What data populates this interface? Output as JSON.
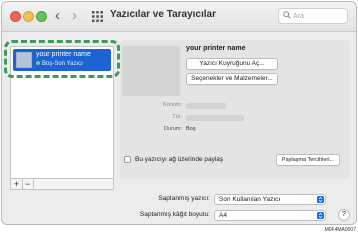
{
  "window": {
    "title": "Yazıcılar ve Tarayıcılar",
    "search_placeholder": "Ara",
    "nav_back_icon": "‹",
    "nav_forward_icon": "›"
  },
  "printer_list": {
    "items": [
      {
        "name": "your printer name",
        "status": "Boş-Son Yazıcı",
        "selected": true
      }
    ],
    "add_label": "+",
    "remove_label": "−"
  },
  "detail": {
    "printer_name": "your printer name",
    "open_queue_button": "Yazıcı Kuyruğunu Aç...",
    "options_button": "Seçenekler ve Malzemeler...",
    "location_label": "Konum:",
    "type_label": "Tür:",
    "status_label": "Durum:",
    "status_value": "Boş",
    "share_checkbox_label": "Bu yazıcıyı ağ üzerinde paylaş",
    "share_checked": false,
    "sharing_prefs_button": "Paylaşma Tercihleri..."
  },
  "defaults": {
    "default_printer_label": "Saptanmış yazıcı:",
    "default_printer_value": "Son Kullanılan Yazıcı",
    "default_paper_label": "Saptanmış kâğıt boyutu:",
    "default_paper_value": "A4",
    "help_label": "?"
  },
  "footer": {
    "image_code": "M0F4MA0007"
  },
  "colors": {
    "selection": "#1d64d2",
    "highlight_border": "#3c9a5a",
    "close": "#ec6559",
    "minimize": "#f5bf4f",
    "maximize": "#61c455"
  }
}
